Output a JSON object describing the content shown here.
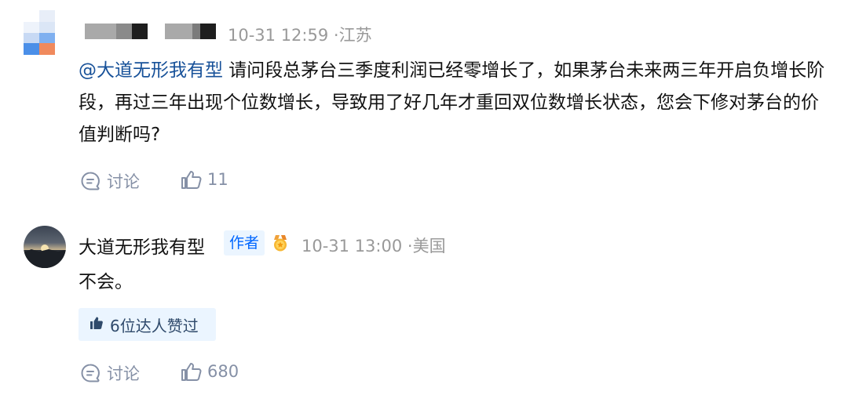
{
  "comment1": {
    "username_redacted": true,
    "time": "10-31 12:59",
    "separator": "·",
    "location": "江苏",
    "mention": "@大道无形我有型",
    "text": " 请问段总茅台三季度利润已经零增长了，如果茅台未来两三年开启负增长阶段，再过三年出现个位数增长，导致用了好几年才重回双位数增长状态，您会下修对茅台的价值判断吗?",
    "reply_label": "讨论",
    "like_count": "11"
  },
  "comment2": {
    "author_name": "大道无形我有型",
    "author_badge": "作者",
    "time": "10-31 13:00",
    "separator": "·",
    "location": "美国",
    "text": "不会。",
    "likers_label": "6位达人赞过",
    "reply_label": "讨论",
    "like_count": "680"
  },
  "colors": {
    "link": "#175199",
    "muted": "#999999",
    "action": "#8590a6",
    "badge_bg": "#ebf5ff",
    "badge_text": "#0066ff"
  },
  "icons": {
    "reply": "comment-bubble-icon",
    "like": "thumbs-up-outline-icon",
    "likers": "thumbs-up-filled-icon",
    "medal": "gold-medal-icon"
  }
}
